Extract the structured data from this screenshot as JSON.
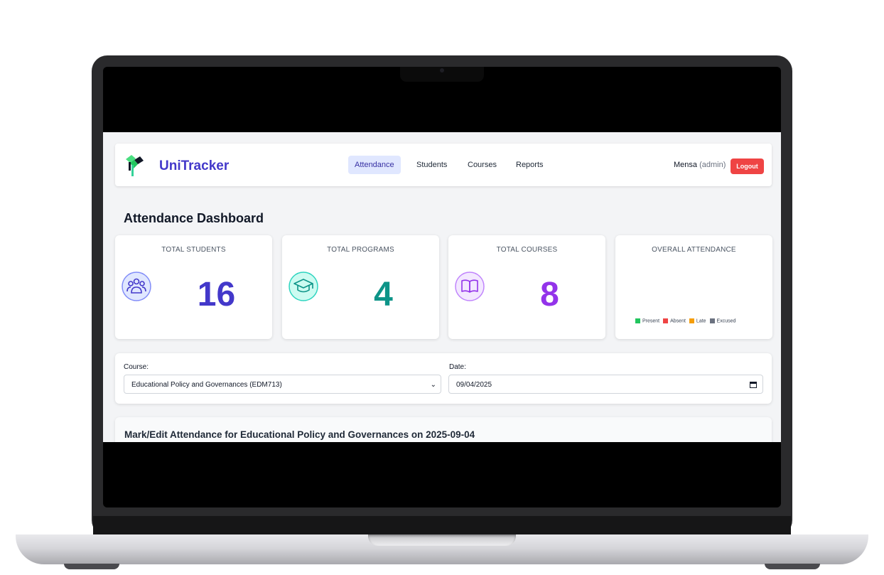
{
  "app": {
    "brand": "UniTracker"
  },
  "nav": {
    "items": [
      {
        "label": "Attendance",
        "active": true
      },
      {
        "label": "Students",
        "active": false
      },
      {
        "label": "Courses",
        "active": false
      },
      {
        "label": "Reports",
        "active": false
      }
    ]
  },
  "user": {
    "name": "Mensa",
    "role": "(admin)",
    "logout_label": "Logout"
  },
  "page": {
    "title": "Attendance Dashboard"
  },
  "stats": {
    "students": {
      "label": "TOTAL STUDENTS",
      "value": "16",
      "icon": "users-icon",
      "color": "#4338ca"
    },
    "programs": {
      "label": "TOTAL PROGRAMS",
      "value": "4",
      "icon": "graduation-cap-icon",
      "color": "#0d9488"
    },
    "courses": {
      "label": "TOTAL COURSES",
      "value": "8",
      "icon": "book-icon",
      "color": "#9333ea"
    },
    "attendance": {
      "label": "OVERALL ATTENDANCE",
      "legend": [
        {
          "label": "Present",
          "color": "#22c55e"
        },
        {
          "label": "Absent",
          "color": "#ef4444"
        },
        {
          "label": "Late",
          "color": "#f59e0b"
        },
        {
          "label": "Excused",
          "color": "#6b7280"
        }
      ]
    }
  },
  "filters": {
    "course_label": "Course:",
    "course_value": "Educational Policy and Governances (EDM713)",
    "date_label": "Date:",
    "date_value": "09/04/2025"
  },
  "mark": {
    "title": "Mark/Edit Attendance for Educational Policy and Governances on 2025-09-04"
  }
}
